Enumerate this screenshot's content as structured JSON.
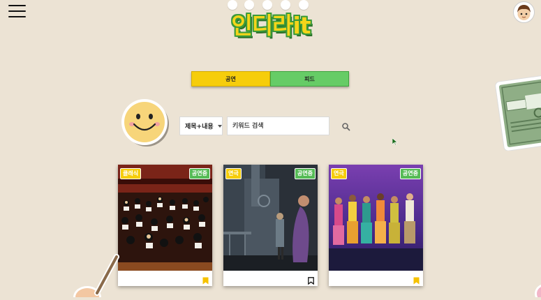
{
  "header": {
    "logo_text": "인디라it",
    "menu_icon": "hamburger-menu-icon",
    "avatar_icon": "user-avatar-icon"
  },
  "tabs": [
    {
      "label": "공연",
      "color": "#f6cd0b"
    },
    {
      "label": "피드",
      "color": "#66cc66"
    }
  ],
  "search": {
    "filter_selected": "제목+내용",
    "placeholder": "키워드 검색",
    "button_icon": "search-icon"
  },
  "cards": [
    {
      "genre": "클래식",
      "status": "공연중",
      "bookmarked": true,
      "image": "orchestra-concert-photo"
    },
    {
      "genre": "연극",
      "status": "공연중",
      "bookmarked": false,
      "image": "theater-stage-photo"
    },
    {
      "genre": "연극",
      "status": "공연중",
      "bookmarked": true,
      "image": "musical-dancers-photo"
    }
  ],
  "colors": {
    "background": "#ece3d4",
    "accent_yellow": "#f6cd0b",
    "accent_green": "#66cc66"
  }
}
